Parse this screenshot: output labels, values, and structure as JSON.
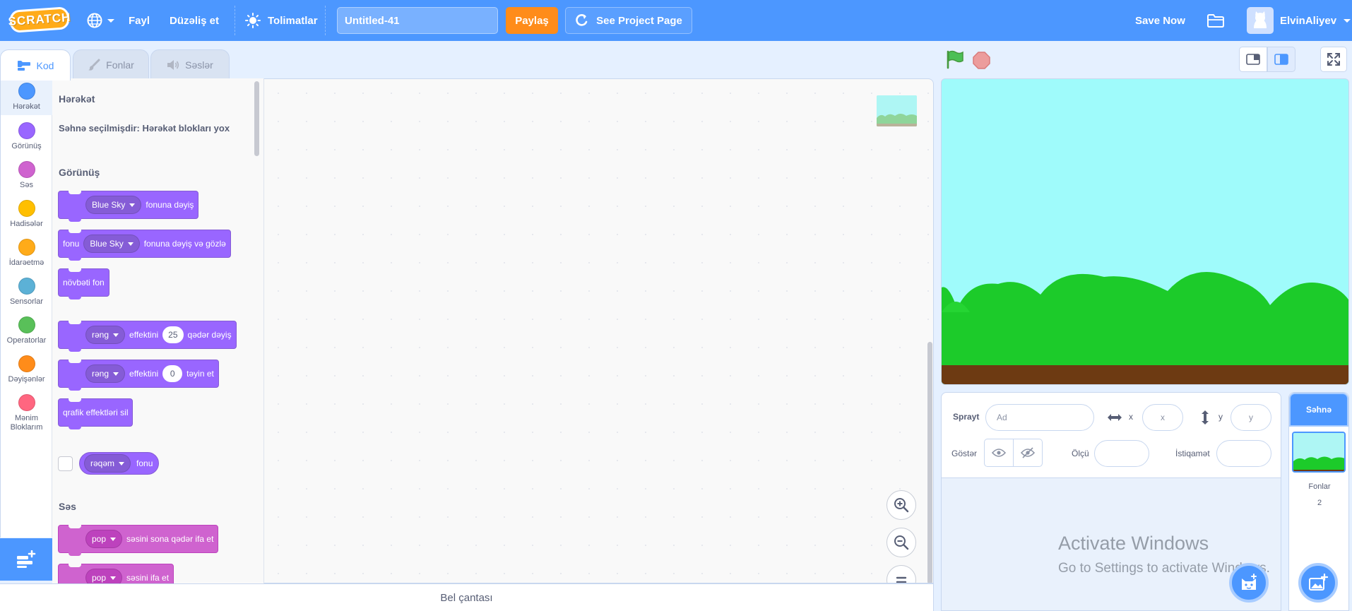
{
  "menubar": {
    "logo": "SCRATCH",
    "file_label": "Fayl",
    "edit_label": "Düzəliş et",
    "tutorials_label": "Tolimatlar",
    "project_title": "Untitled-41",
    "share_label": "Paylaş",
    "see_project_label": "See Project Page",
    "save_label": "Save Now",
    "username": "ElvinAliyev",
    "icons": [
      "globe-icon",
      "chevron-down-icon",
      "bulb-icon",
      "remix-icon",
      "folder-icon",
      "avatar-icon"
    ]
  },
  "tabs": {
    "code": "Kod",
    "costumes": "Fonlar",
    "sounds": "Səslər"
  },
  "categories": [
    {
      "label": "Hərəkət",
      "color": "#4c97ff"
    },
    {
      "label": "Görünüş",
      "color": "#9966ff"
    },
    {
      "label": "Səs",
      "color": "#cf63cf"
    },
    {
      "label": "Hadisələr",
      "color": "#ffbf00"
    },
    {
      "label": "İdarəetmə",
      "color": "#ffab19"
    },
    {
      "label": "Sensorlar",
      "color": "#5cb1d6"
    },
    {
      "label": "Operatorlar",
      "color": "#59c059"
    },
    {
      "label": "Dəyişənlər",
      "color": "#ff8c1a"
    },
    {
      "label": "Mənim Bloklarım",
      "color": "#ff6680"
    }
  ],
  "palette": {
    "motion_heading": "Hərəkət",
    "motion_note": "Səhnə seçilmişdir: Hərəkət blokları yox",
    "looks_heading": "Görünüş",
    "switch_backdrop": {
      "menu": "Blue Sky",
      "text": "fonuna dəyiş"
    },
    "switch_backdrop_wait": {
      "prefix": "fonu",
      "menu": "Blue Sky",
      "text": "fonuna dəyiş və gözlə"
    },
    "next_backdrop": "növbəti fon",
    "change_effect": {
      "menu": "rəng",
      "text1": "effektini",
      "value": "25",
      "text2": "qədər dəyiş"
    },
    "set_effect": {
      "menu": "rəng",
      "text1": "effektini",
      "value": "0",
      "text2": "təyin et"
    },
    "clear_effects": "qrafik effektləri sil",
    "backdrop_reporter": {
      "menu": "rəqəm",
      "text": "fonu"
    },
    "sound_heading": "Səs",
    "play_until_done": {
      "menu": "pop",
      "text": "səsini sona qədər ifa et"
    },
    "start_sound": {
      "menu": "pop",
      "text": "səsini ifa et"
    }
  },
  "workspace": {
    "backpack_label": "Bel çantası"
  },
  "sprite_info": {
    "sprite_label": "Sprayt",
    "name_placeholder": "Ad",
    "x_label": "x",
    "x_placeholder": "x",
    "y_label": "y",
    "y_placeholder": "y",
    "show_label": "Göstər",
    "size_label": "Ölçü",
    "direction_label": "İstiqamət"
  },
  "stage_selector": {
    "title": "Səhnə",
    "backdrops_label": "Fonlar",
    "backdrops_count": "2"
  },
  "watermark": {
    "line1": "Activate Windows",
    "line2": "Go to Settings to activate Windows."
  },
  "colors": {
    "accent": "#4c97ff",
    "looks": "#9966ff",
    "sound": "#cf63cf",
    "share": "#ff8c1a",
    "sky": "#9ffbfb",
    "bushes": "#1ccb2a",
    "ground": "#6d3a12"
  }
}
